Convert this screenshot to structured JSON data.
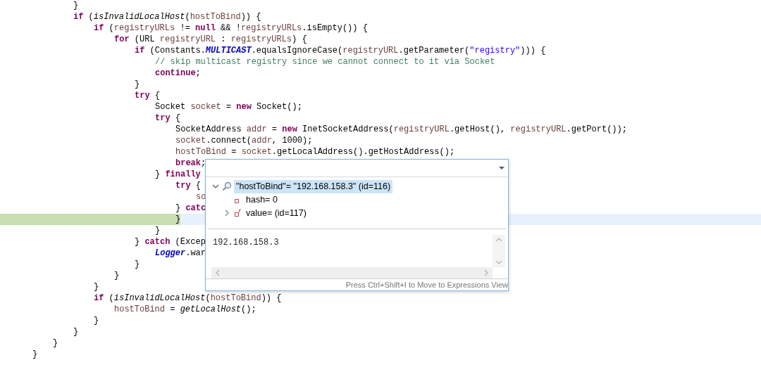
{
  "code_outline": [
    {
      "children": [
        {
          "children": [
            {
              "tokens": [
                {
                  "kind": "plain",
                  "text": "}"
                }
              ]
            },
            {
              "tokens": [
                {
                  "kind": "keyword",
                  "text": "if"
                },
                {
                  "kind": "plain",
                  "text": " ("
                },
                {
                  "kind": "method",
                  "text": "isInvalidLocalHost"
                },
                {
                  "kind": "plain",
                  "text": "("
                },
                {
                  "kind": "variable",
                  "text": "hostToBind"
                },
                {
                  "kind": "plain",
                  "text": ")) {"
                }
              ],
              "children": [
                {
                  "tokens": [
                    {
                      "kind": "keyword",
                      "text": "if"
                    },
                    {
                      "kind": "plain",
                      "text": " ("
                    },
                    {
                      "kind": "variable",
                      "text": "registryURLs"
                    },
                    {
                      "kind": "plain",
                      "text": " != "
                    },
                    {
                      "kind": "keyword",
                      "text": "null"
                    },
                    {
                      "kind": "plain",
                      "text": " && !"
                    },
                    {
                      "kind": "variable",
                      "text": "registryURLs"
                    },
                    {
                      "kind": "plain",
                      "text": ".isEmpty()) {"
                    }
                  ],
                  "children": [
                    {
                      "tokens": [
                        {
                          "kind": "keyword",
                          "text": "for"
                        },
                        {
                          "kind": "plain",
                          "text": " (URL "
                        },
                        {
                          "kind": "variable",
                          "text": "registryURL"
                        },
                        {
                          "kind": "plain",
                          "text": " : "
                        },
                        {
                          "kind": "variable",
                          "text": "registryURLs"
                        },
                        {
                          "kind": "plain",
                          "text": ") {"
                        }
                      ],
                      "children": [
                        {
                          "tokens": [
                            {
                              "kind": "keyword",
                              "text": "if"
                            },
                            {
                              "kind": "plain",
                              "text": " (Constants."
                            },
                            {
                              "kind": "constant",
                              "text": "MULTICAST"
                            },
                            {
                              "kind": "plain",
                              "text": ".equalsIgnoreCase("
                            },
                            {
                              "kind": "variable",
                              "text": "registryURL"
                            },
                            {
                              "kind": "plain",
                              "text": ".getParameter("
                            },
                            {
                              "kind": "string",
                              "text": "\"registry\""
                            },
                            {
                              "kind": "plain",
                              "text": "))) {"
                            }
                          ],
                          "children": [
                            {
                              "tokens": [
                                {
                                  "kind": "comment",
                                  "text": "// skip multicast registry since we cannot connect to it via Socket"
                                }
                              ]
                            },
                            {
                              "tokens": [
                                {
                                  "kind": "keyword",
                                  "text": "continue"
                                },
                                {
                                  "kind": "plain",
                                  "text": ";"
                                }
                              ]
                            }
                          ]
                        },
                        {
                          "tokens": [
                            {
                              "kind": "plain",
                              "text": "}"
                            }
                          ]
                        },
                        {
                          "tokens": [
                            {
                              "kind": "keyword",
                              "text": "try"
                            },
                            {
                              "kind": "plain",
                              "text": " {"
                            }
                          ],
                          "children": [
                            {
                              "tokens": [
                                {
                                  "kind": "plain",
                                  "text": "Socket "
                                },
                                {
                                  "kind": "variable",
                                  "text": "socket"
                                },
                                {
                                  "kind": "plain",
                                  "text": " = "
                                },
                                {
                                  "kind": "keyword",
                                  "text": "new"
                                },
                                {
                                  "kind": "plain",
                                  "text": " Socket();"
                                }
                              ]
                            },
                            {
                              "tokens": [
                                {
                                  "kind": "keyword",
                                  "text": "try"
                                },
                                {
                                  "kind": "plain",
                                  "text": " {"
                                }
                              ],
                              "children": [
                                {
                                  "tokens": [
                                    {
                                      "kind": "plain",
                                      "text": "SocketAddress "
                                    },
                                    {
                                      "kind": "variable",
                                      "text": "addr"
                                    },
                                    {
                                      "kind": "plain",
                                      "text": " = "
                                    },
                                    {
                                      "kind": "keyword",
                                      "text": "new"
                                    },
                                    {
                                      "kind": "plain",
                                      "text": " InetSocketAddress("
                                    },
                                    {
                                      "kind": "variable",
                                      "text": "registryURL"
                                    },
                                    {
                                      "kind": "plain",
                                      "text": ".getHost(), "
                                    },
                                    {
                                      "kind": "variable",
                                      "text": "registryURL"
                                    },
                                    {
                                      "kind": "plain",
                                      "text": ".getPort());"
                                    }
                                  ]
                                },
                                {
                                  "tokens": [
                                    {
                                      "kind": "variable",
                                      "text": "socket"
                                    },
                                    {
                                      "kind": "plain",
                                      "text": ".connect("
                                    },
                                    {
                                      "kind": "variable",
                                      "text": "addr"
                                    },
                                    {
                                      "kind": "plain",
                                      "text": ", 1000);"
                                    }
                                  ]
                                },
                                {
                                  "tokens": [
                                    {
                                      "kind": "variable",
                                      "text": "hostToBind"
                                    },
                                    {
                                      "kind": "plain",
                                      "text": " = "
                                    },
                                    {
                                      "kind": "variable",
                                      "text": "socket"
                                    },
                                    {
                                      "kind": "plain",
                                      "text": ".getLocalAddress().getHostAddress();"
                                    }
                                  ]
                                },
                                {
                                  "tokens": [
                                    {
                                      "kind": "keyword",
                                      "text": "break"
                                    },
                                    {
                                      "kind": "plain",
                                      "text": ";"
                                    }
                                  ]
                                }
                              ]
                            },
                            {
                              "tokens": [
                                {
                                  "kind": "plain",
                                  "text": "} "
                                },
                                {
                                  "kind": "keyword",
                                  "text": "finally"
                                }
                              ],
                              "children": [
                                {
                                  "tokens": [
                                    {
                                      "kind": "keyword",
                                      "text": "try"
                                    },
                                    {
                                      "kind": "plain",
                                      "text": " {"
                                    }
                                  ],
                                  "children": [
                                    {
                                      "tokens": [
                                        {
                                          "kind": "variable",
                                          "text": "so"
                                        }
                                      ]
                                    }
                                  ]
                                },
                                {
                                  "tokens": [
                                    {
                                      "kind": "plain",
                                      "text": "} "
                                    },
                                    {
                                      "kind": "keyword",
                                      "text": "catc"
                                    }
                                  ]
                                },
                                {
                                  "tokens": [
                                    {
                                      "kind": "plain",
                                      "text": "}"
                                    }
                                  ],
                                  "current": true
                                }
                              ]
                            },
                            {
                              "tokens": [
                                {
                                  "kind": "plain",
                                  "text": "}"
                                }
                              ]
                            }
                          ]
                        },
                        {
                          "tokens": [
                            {
                              "kind": "plain",
                              "text": "} "
                            },
                            {
                              "kind": "keyword",
                              "text": "catch"
                            },
                            {
                              "kind": "plain",
                              "text": " (Excep"
                            }
                          ],
                          "children": [
                            {
                              "tokens": [
                                {
                                  "kind": "constant",
                                  "text": "Logger"
                                },
                                {
                                  "kind": "plain",
                                  "text": ".war"
                                }
                              ]
                            }
                          ]
                        },
                        {
                          "tokens": [
                            {
                              "kind": "plain",
                              "text": "}"
                            }
                          ]
                        }
                      ]
                    },
                    {
                      "tokens": [
                        {
                          "kind": "plain",
                          "text": "}"
                        }
                      ]
                    }
                  ]
                },
                {
                  "tokens": [
                    {
                      "kind": "plain",
                      "text": "}"
                    }
                  ]
                },
                {
                  "tokens": [
                    {
                      "kind": "keyword",
                      "text": "if"
                    },
                    {
                      "kind": "plain",
                      "text": " ("
                    },
                    {
                      "kind": "method",
                      "text": "isInvalidLocalHost"
                    },
                    {
                      "kind": "plain",
                      "text": "("
                    },
                    {
                      "kind": "variable",
                      "text": "hostToBind"
                    },
                    {
                      "kind": "plain",
                      "text": ")) {"
                    }
                  ],
                  "children": [
                    {
                      "tokens": [
                        {
                          "kind": "variable",
                          "text": "hostToBind"
                        },
                        {
                          "kind": "plain",
                          "text": " = "
                        },
                        {
                          "kind": "method",
                          "text": "getLocalHost"
                        },
                        {
                          "kind": "plain",
                          "text": "();"
                        }
                      ]
                    }
                  ]
                },
                {
                  "tokens": [
                    {
                      "kind": "plain",
                      "text": "}"
                    }
                  ]
                }
              ]
            },
            {
              "tokens": [
                {
                  "kind": "plain",
                  "text": "}"
                }
              ]
            }
          ]
        },
        {
          "tokens": [
            {
              "kind": "plain",
              "text": "}"
            }
          ]
        }
      ]
    },
    {
      "tokens": [
        {
          "kind": "plain",
          "text": "}"
        }
      ]
    }
  ],
  "inspect_popup": {
    "tree": [
      {
        "label": "\"hostToBind\"= \"192.168.158.3\" (id=116)",
        "kind": "expression",
        "expanded": true,
        "selected": true,
        "children": [
          {
            "label": "hash= 0",
            "kind": "field",
            "final": false,
            "selected": false
          },
          {
            "label": "value= (id=117)",
            "kind": "field",
            "final": true,
            "expanded": false,
            "selected": false
          }
        ]
      }
    ],
    "detail": "192.168.158.3",
    "hint": "Press Ctrl+Shift+I to Move to Expressions View"
  }
}
